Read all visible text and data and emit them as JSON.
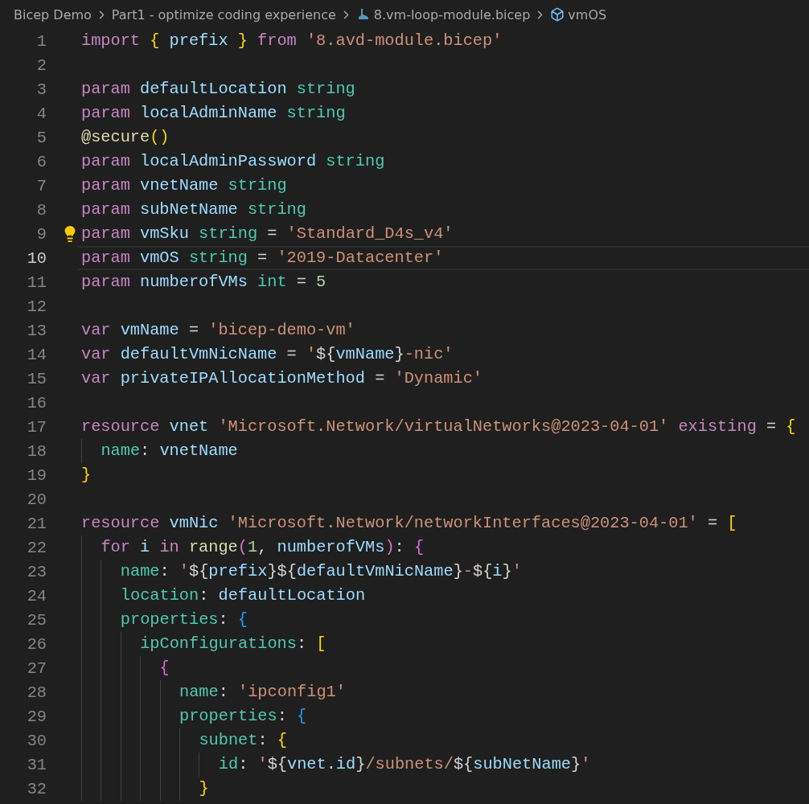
{
  "breadcrumb": [
    {
      "kind": "folder",
      "label": "Bicep Demo"
    },
    {
      "kind": "folder",
      "label": "Part1 - optimize coding experience"
    },
    {
      "kind": "file",
      "label": "8.vm-loop-module.bicep"
    },
    {
      "kind": "symbol",
      "label": "vmOS"
    }
  ],
  "editor": {
    "lines": [
      {
        "number": "1",
        "current": false,
        "tokens": [
          {
            "kind": "keyword",
            "text": "import"
          },
          {
            "kind": "bracket",
            "text": "{",
            "color": "#ffd700"
          },
          {
            "kind": "identifier",
            "text": "prefix"
          },
          {
            "kind": "bracket",
            "text": "}",
            "color": "#ffd700"
          },
          {
            "kind": "keyword",
            "text": "from"
          },
          {
            "kind": "string",
            "text": "'8.avd-module.bicep'"
          }
        ]
      },
      {
        "number": "2",
        "current": false
      },
      {
        "number": "3",
        "current": false,
        "tokens": [
          {
            "kind": "keyword",
            "text": "param"
          },
          {
            "kind": "identifier",
            "text": "defaultLocation"
          },
          {
            "kind": "type",
            "text": "string"
          }
        ]
      },
      {
        "number": "4",
        "current": false,
        "tokens": [
          {
            "kind": "keyword",
            "text": "param"
          },
          {
            "kind": "identifier",
            "text": "localAdminName"
          },
          {
            "kind": "type",
            "text": "string"
          }
        ]
      },
      {
        "number": "5",
        "current": false,
        "tokens": [
          {
            "kind": "function",
            "text": "@secure"
          },
          {
            "kind": "bracket",
            "text": "()",
            "color": "#ffd700",
            "glued": true
          }
        ]
      },
      {
        "number": "6",
        "current": false,
        "tokens": [
          {
            "kind": "keyword",
            "text": "param"
          },
          {
            "kind": "identifier",
            "text": "localAdminPassword"
          },
          {
            "kind": "type",
            "text": "string"
          }
        ]
      },
      {
        "number": "7",
        "current": false,
        "tokens": [
          {
            "kind": "keyword",
            "text": "param"
          },
          {
            "kind": "identifier",
            "text": "vnetName"
          },
          {
            "kind": "type",
            "text": "string"
          }
        ]
      },
      {
        "number": "8",
        "current": false,
        "tokens": [
          {
            "kind": "keyword",
            "text": "param"
          },
          {
            "kind": "identifier",
            "text": "subNetName"
          },
          {
            "kind": "type",
            "text": "string"
          }
        ]
      },
      {
        "number": "9",
        "current": false,
        "lightbulb": true,
        "tokens": [
          {
            "kind": "keyword",
            "text": "param"
          },
          {
            "kind": "identifier",
            "text": "vmSku"
          },
          {
            "kind": "type",
            "text": "string"
          },
          {
            "kind": "operator",
            "text": "="
          },
          {
            "kind": "string",
            "text": "'Standard_D4s_v4'"
          }
        ]
      },
      {
        "number": "10",
        "current": true,
        "tokens": [
          {
            "kind": "keyword",
            "text": "param"
          },
          {
            "kind": "identifier",
            "text": "vmOS"
          },
          {
            "kind": "type",
            "text": "string"
          },
          {
            "kind": "operator",
            "text": "="
          },
          {
            "kind": "string",
            "text": "'2019-Datacenter'"
          }
        ]
      },
      {
        "number": "11",
        "current": false,
        "tokens": [
          {
            "kind": "keyword",
            "text": "param"
          },
          {
            "kind": "identifier",
            "text": "numberofVMs"
          },
          {
            "kind": "type",
            "text": "int"
          },
          {
            "kind": "operator",
            "text": "="
          },
          {
            "kind": "number",
            "text": "5"
          }
        ]
      },
      {
        "number": "12",
        "current": false
      },
      {
        "number": "13",
        "current": false,
        "tokens": [
          {
            "kind": "keyword",
            "text": "var"
          },
          {
            "kind": "identifier",
            "text": "vmName"
          },
          {
            "kind": "operator",
            "text": "="
          },
          {
            "kind": "string",
            "text": "'bicep-demo-vm'"
          }
        ]
      },
      {
        "number": "14",
        "current": false,
        "tokens": [
          {
            "kind": "keyword",
            "text": "var"
          },
          {
            "kind": "identifier",
            "text": "defaultVmNicName"
          },
          {
            "kind": "operator",
            "text": "="
          },
          {
            "kind": "string",
            "text": "'"
          },
          {
            "kind": "interpolation",
            "text": "${",
            "glued": true
          },
          {
            "kind": "identifier",
            "text": "vmName",
            "glued": true
          },
          {
            "kind": "interpolation",
            "text": "}",
            "glued": true
          },
          {
            "kind": "string",
            "text": "-nic'",
            "glued": true
          }
        ]
      },
      {
        "number": "15",
        "current": false,
        "tokens": [
          {
            "kind": "keyword",
            "text": "var"
          },
          {
            "kind": "identifier",
            "text": "privateIPAllocationMethod"
          },
          {
            "kind": "operator",
            "text": "="
          },
          {
            "kind": "string",
            "text": "'Dynamic'"
          }
        ]
      },
      {
        "number": "16",
        "current": false
      },
      {
        "number": "17",
        "current": false,
        "tokens": [
          {
            "kind": "keyword",
            "text": "resource"
          },
          {
            "kind": "identifier",
            "text": "vnet"
          },
          {
            "kind": "string",
            "text": "'Microsoft.Network/virtualNetworks@2023-04-01'"
          },
          {
            "kind": "keyword",
            "text": "existing"
          },
          {
            "kind": "operator",
            "text": "="
          },
          {
            "kind": "bracket",
            "text": "{",
            "color": "#ffd700"
          }
        ],
        "children": [
          {
            "number": "18",
            "current": false,
            "tokens": [
              {
                "kind": "property",
                "text": "name"
              },
              {
                "kind": "punctuation",
                "text": ":",
                "glued": true
              },
              {
                "kind": "identifier",
                "text": "vnetName"
              }
            ]
          }
        ]
      },
      {
        "number": "19",
        "current": false,
        "tokens": [
          {
            "kind": "bracket",
            "text": "}",
            "color": "#ffd700"
          }
        ]
      },
      {
        "number": "20",
        "current": false
      },
      {
        "number": "21",
        "current": false,
        "tokens": [
          {
            "kind": "keyword",
            "text": "resource"
          },
          {
            "kind": "identifier",
            "text": "vmNic"
          },
          {
            "kind": "string",
            "text": "'Microsoft.Network/networkInterfaces@2023-04-01'"
          },
          {
            "kind": "operator",
            "text": "="
          },
          {
            "kind": "bracket",
            "text": "[",
            "color": "#ffd700"
          }
        ],
        "children": [
          {
            "number": "22",
            "current": false,
            "tokens": [
              {
                "kind": "keyword",
                "text": "for"
              },
              {
                "kind": "identifier",
                "text": "i"
              },
              {
                "kind": "keyword",
                "text": "in"
              },
              {
                "kind": "function",
                "text": "range"
              },
              {
                "kind": "bracket",
                "text": "(",
                "color": "#da70d6",
                "glued": true
              },
              {
                "kind": "number",
                "text": "1",
                "glued": true
              },
              {
                "kind": "punctuation",
                "text": ",",
                "glued": true
              },
              {
                "kind": "identifier",
                "text": "numberofVMs"
              },
              {
                "kind": "bracket",
                "text": ")",
                "color": "#da70d6",
                "glued": true
              },
              {
                "kind": "punctuation",
                "text": ":",
                "glued": true
              },
              {
                "kind": "bracket",
                "text": "{",
                "color": "#da70d6"
              }
            ],
            "children": [
              {
                "number": "23",
                "current": false,
                "tokens": [
                  {
                    "kind": "property",
                    "text": "name"
                  },
                  {
                    "kind": "punctuation",
                    "text": ":",
                    "glued": true
                  },
                  {
                    "kind": "string",
                    "text": "'"
                  },
                  {
                    "kind": "interpolation",
                    "text": "${",
                    "glued": true
                  },
                  {
                    "kind": "identifier",
                    "text": "prefix",
                    "glued": true
                  },
                  {
                    "kind": "interpolation",
                    "text": "}${",
                    "glued": true
                  },
                  {
                    "kind": "identifier",
                    "text": "defaultVmNicName",
                    "glued": true
                  },
                  {
                    "kind": "interpolation",
                    "text": "}",
                    "glued": true
                  },
                  {
                    "kind": "string",
                    "text": "-",
                    "glued": true
                  },
                  {
                    "kind": "interpolation",
                    "text": "${",
                    "glued": true
                  },
                  {
                    "kind": "identifier",
                    "text": "i",
                    "glued": true
                  },
                  {
                    "kind": "interpolation",
                    "text": "}",
                    "glued": true
                  },
                  {
                    "kind": "string",
                    "text": "'",
                    "glued": true
                  }
                ]
              },
              {
                "number": "24",
                "current": false,
                "tokens": [
                  {
                    "kind": "property",
                    "text": "location"
                  },
                  {
                    "kind": "punctuation",
                    "text": ":",
                    "glued": true
                  },
                  {
                    "kind": "identifier",
                    "text": "defaultLocation"
                  }
                ]
              },
              {
                "number": "25",
                "current": false,
                "tokens": [
                  {
                    "kind": "property",
                    "text": "properties"
                  },
                  {
                    "kind": "punctuation",
                    "text": ":",
                    "glued": true
                  },
                  {
                    "kind": "bracket",
                    "text": "{",
                    "color": "#179fff"
                  }
                ],
                "children": [
                  {
                    "number": "26",
                    "current": false,
                    "tokens": [
                      {
                        "kind": "property",
                        "text": "ipConfigurations"
                      },
                      {
                        "kind": "punctuation",
                        "text": ":",
                        "glued": true
                      },
                      {
                        "kind": "bracket",
                        "text": "[",
                        "color": "#ffd700"
                      }
                    ],
                    "children": [
                      {
                        "number": "27",
                        "current": false,
                        "tokens": [
                          {
                            "kind": "bracket",
                            "text": "{",
                            "color": "#da70d6"
                          }
                        ],
                        "children": [
                          {
                            "number": "28",
                            "current": false,
                            "tokens": [
                              {
                                "kind": "property",
                                "text": "name"
                              },
                              {
                                "kind": "punctuation",
                                "text": ":",
                                "glued": true
                              },
                              {
                                "kind": "string",
                                "text": "'ipconfig1'"
                              }
                            ]
                          },
                          {
                            "number": "29",
                            "current": false,
                            "tokens": [
                              {
                                "kind": "property",
                                "text": "properties"
                              },
                              {
                                "kind": "punctuation",
                                "text": ":",
                                "glued": true
                              },
                              {
                                "kind": "bracket",
                                "text": "{",
                                "color": "#179fff"
                              }
                            ],
                            "children": [
                              {
                                "number": "30",
                                "current": false,
                                "tokens": [
                                  {
                                    "kind": "property",
                                    "text": "subnet"
                                  },
                                  {
                                    "kind": "punctuation",
                                    "text": ":",
                                    "glued": true
                                  },
                                  {
                                    "kind": "bracket",
                                    "text": "{",
                                    "color": "#ffd700"
                                  }
                                ],
                                "children": [
                                  {
                                    "number": "31",
                                    "current": false,
                                    "tokens": [
                                      {
                                        "kind": "property",
                                        "text": "id"
                                      },
                                      {
                                        "kind": "punctuation",
                                        "text": ":",
                                        "glued": true
                                      },
                                      {
                                        "kind": "string",
                                        "text": "'"
                                      },
                                      {
                                        "kind": "interpolation",
                                        "text": "${",
                                        "glued": true
                                      },
                                      {
                                        "kind": "identifier",
                                        "text": "vnet.id",
                                        "glued": true
                                      },
                                      {
                                        "kind": "interpolation",
                                        "text": "}",
                                        "glued": true
                                      },
                                      {
                                        "kind": "string",
                                        "text": "/subnets/",
                                        "glued": true
                                      },
                                      {
                                        "kind": "interpolation",
                                        "text": "${",
                                        "glued": true
                                      },
                                      {
                                        "kind": "identifier",
                                        "text": "subNetName",
                                        "glued": true
                                      },
                                      {
                                        "kind": "interpolation",
                                        "text": "}",
                                        "glued": true
                                      },
                                      {
                                        "kind": "string",
                                        "text": "'",
                                        "glued": true
                                      }
                                    ]
                                  }
                                ]
                              },
                              {
                                "number": "32",
                                "current": false,
                                "tokens": [
                                  {
                                    "kind": "bracket",
                                    "text": "}",
                                    "color": "#ffd700"
                                  }
                                ]
                              }
                            ]
                          }
                        ]
                      }
                    ]
                  }
                ]
              }
            ]
          }
        ]
      }
    ]
  }
}
